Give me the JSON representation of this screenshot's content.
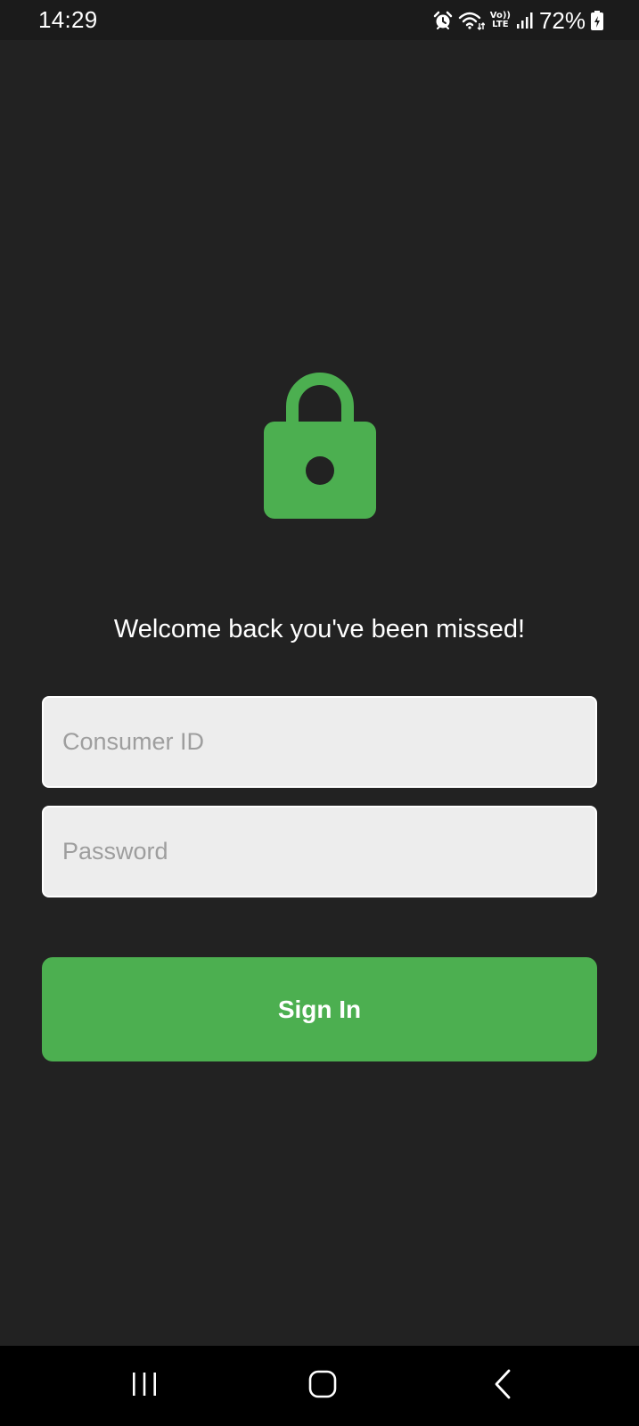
{
  "status_bar": {
    "time": "14:29",
    "volte_top": "Vo))",
    "volte_bottom": "LTE",
    "battery_percent": "72%",
    "icons": [
      "alarm-icon",
      "wifi-icon",
      "volte-icon",
      "signal-icon",
      "battery-icon"
    ]
  },
  "login": {
    "icon": "lock-icon",
    "welcome": "Welcome back you've been missed!",
    "consumer_id_placeholder": "Consumer ID",
    "consumer_id_value": "",
    "password_placeholder": "Password",
    "password_value": "",
    "sign_in_label": "Sign In"
  },
  "nav_bar": {
    "icons": [
      "recents-icon",
      "home-icon",
      "back-icon"
    ]
  },
  "colors": {
    "background": "#222222",
    "accent": "#4caf50",
    "input_background": "#ededed",
    "placeholder": "#9e9e9e"
  }
}
